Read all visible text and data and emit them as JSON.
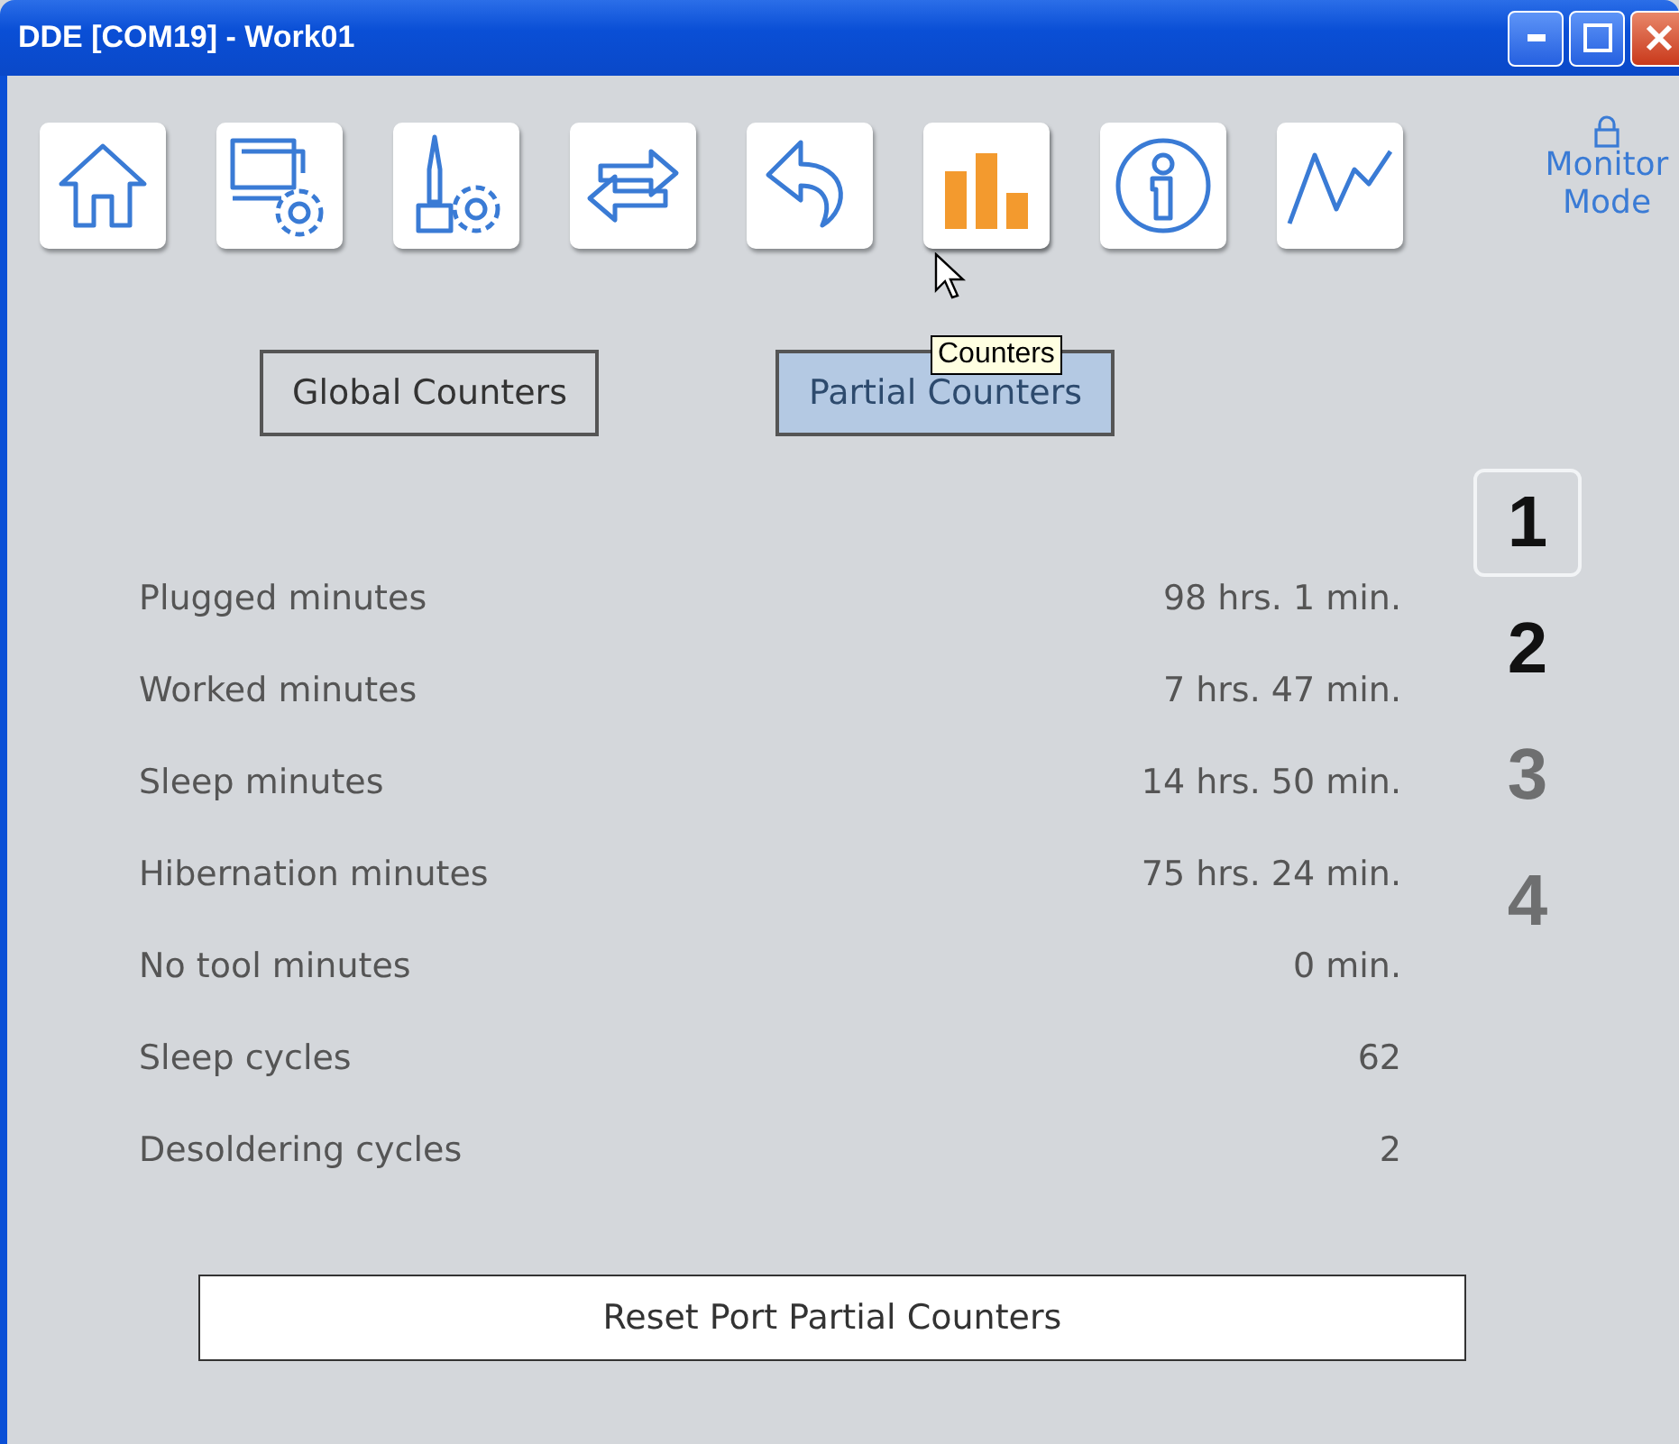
{
  "window": {
    "title": "DDE [COM19] - Work01"
  },
  "toolbar": [
    {
      "kind": "home",
      "selected": false
    },
    {
      "kind": "station",
      "selected": false
    },
    {
      "kind": "tool",
      "selected": false
    },
    {
      "kind": "swap",
      "selected": false
    },
    {
      "kind": "back",
      "selected": false
    },
    {
      "kind": "counters",
      "selected": true
    },
    {
      "kind": "info",
      "selected": false
    },
    {
      "kind": "graph",
      "selected": false
    }
  ],
  "monitor_mode": {
    "label": "Monitor Mode"
  },
  "tooltip": "Counters",
  "tabs": [
    {
      "label": "Global Counters",
      "selected": false
    },
    {
      "label": "Partial Counters",
      "selected": true
    }
  ],
  "counters": [
    {
      "label": "Plugged minutes",
      "value": "98 hrs. 1 min."
    },
    {
      "label": "Worked minutes",
      "value": "7 hrs. 47 min."
    },
    {
      "label": "Sleep minutes",
      "value": "14 hrs. 50 min."
    },
    {
      "label": "Hibernation minutes",
      "value": "75 hrs. 24 min."
    },
    {
      "label": "No tool minutes",
      "value": "0 min."
    },
    {
      "label": "Sleep cycles",
      "value": "62"
    },
    {
      "label": "Desoldering cycles",
      "value": "2"
    }
  ],
  "ports": [
    {
      "label": "1",
      "selected": true,
      "disabled": false
    },
    {
      "label": "2",
      "selected": false,
      "disabled": false
    },
    {
      "label": "3",
      "selected": false,
      "disabled": true
    },
    {
      "label": "4",
      "selected": false,
      "disabled": true
    }
  ],
  "reset_button": "Reset Port Partial Counters"
}
